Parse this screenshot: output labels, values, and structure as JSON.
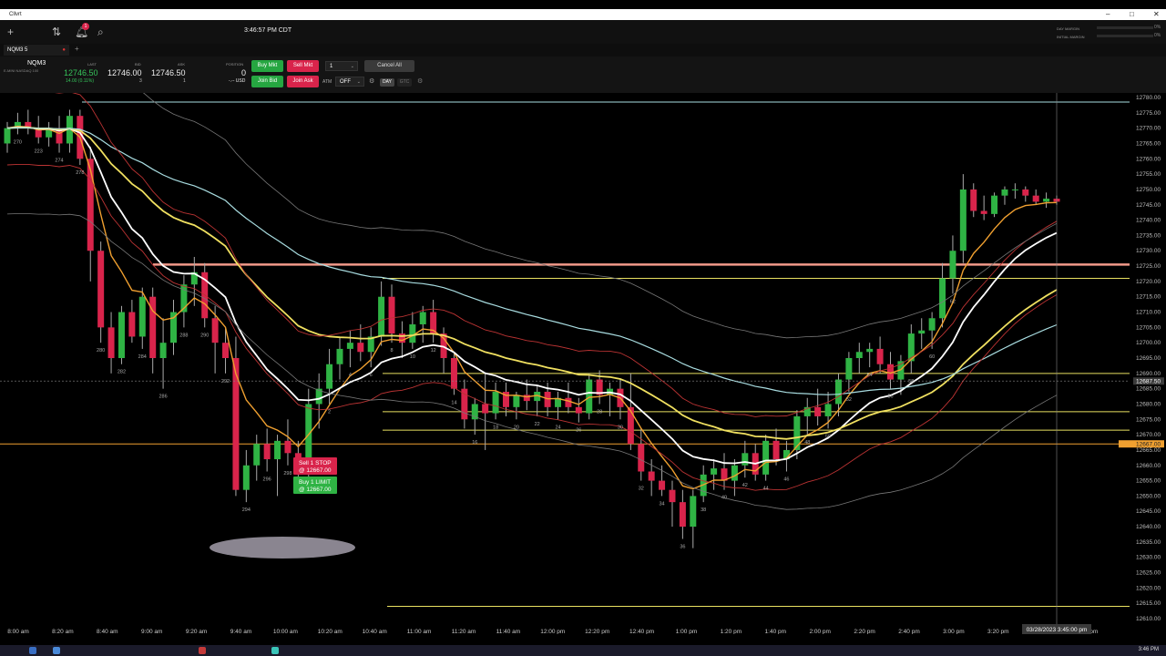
{
  "window": {
    "title": "Cllvrt"
  },
  "header": {
    "time": "3:46:57 PM CDT",
    "notification_count": "1",
    "day_margin_label": "DAY MARGIN",
    "initial_margin_label": "INITIAL MARGIN",
    "day_margin_pct": "0%",
    "initial_margin_pct": "0%"
  },
  "tab": {
    "label": "NQM3 5"
  },
  "quote": {
    "symbol": "NQM3",
    "description": "E-MINI NASDAQ 100",
    "last_label": "LAST",
    "last": "12746.50",
    "change": "14.00 (0.11%)",
    "bid_label": "BID",
    "bid": "12746.00",
    "bid_size": "3",
    "ask_label": "ASK",
    "ask": "12746.50",
    "ask_size": "1",
    "position_label": "POSITION",
    "position": "0",
    "pnl": "-.-- USD"
  },
  "order_entry": {
    "buy_mkt": "Buy Mkt",
    "sell_mkt": "Sell Mkt",
    "qty": "1",
    "cancel_all": "Cancel All",
    "join_bid": "Join Bid",
    "join_ask": "Join Ask",
    "atm_label": "ATM",
    "atm_value": "OFF",
    "day": "DAY",
    "gtc": "GTC"
  },
  "chart_data": {
    "type": "candlestick",
    "y_ticks": [
      "12780.00",
      "12775.00",
      "12770.00",
      "12765.00",
      "12760.00",
      "12755.00",
      "12750.00",
      "12745.00",
      "12740.00",
      "12735.00",
      "12730.00",
      "12725.00",
      "12720.00",
      "12715.00",
      "12710.00",
      "12705.00",
      "12700.00",
      "12695.00",
      "12690.00",
      "12685.00",
      "12680.00",
      "12675.00",
      "12670.00",
      "12665.00",
      "12660.00",
      "12655.00",
      "12650.00",
      "12645.00",
      "12640.00",
      "12635.00",
      "12630.00",
      "12625.00",
      "12620.00",
      "12615.00",
      "12610.00"
    ],
    "ylim": [
      12610,
      12780
    ],
    "x_ticks": [
      "8:00 am",
      "8:20 am",
      "8:40 am",
      "9:00 am",
      "9:20 am",
      "9:40 am",
      "10:00 am",
      "10:20 am",
      "10:40 am",
      "11:00 am",
      "11:20 am",
      "11:40 am",
      "12:00 pm",
      "12:20 pm",
      "12:40 pm",
      "1:00 pm",
      "1:20 pm",
      "1:40 pm",
      "2:00 pm",
      "2:20 pm",
      "2:40 pm",
      "3:00 pm",
      "3:20 pm",
      "3:40 pm",
      "4:00 pm"
    ],
    "crosshair_time": "03/28/2023 3:45:00 pm",
    "crosshair_price": "12687.50",
    "price_flags": [
      "12667.00",
      "12667.00"
    ],
    "horizontal_levels": [
      12778.5,
      12725.5,
      12721.0,
      12690.0,
      12677.5,
      12671.5,
      12667.0,
      12614.0
    ],
    "orders": [
      {
        "label": "Sell 1 STOP",
        "price_label": "@ 12667.00",
        "side": "sell"
      },
      {
        "label": "Buy 1 LIMIT",
        "price_label": "@ 12667.00",
        "side": "buy"
      }
    ],
    "candles": [
      [
        12765,
        12772,
        12762,
        12770
      ],
      [
        12770,
        12775,
        12768,
        12772
      ],
      [
        12772,
        12776,
        12768,
        12770
      ],
      [
        12770,
        12774,
        12765,
        12767
      ],
      [
        12767,
        12772,
        12764,
        12770
      ],
      [
        12770,
        12774,
        12762,
        12765
      ],
      [
        12765,
        12776,
        12762,
        12774
      ],
      [
        12774,
        12776,
        12758,
        12760
      ],
      [
        12760,
        12764,
        12720,
        12730
      ],
      [
        12730,
        12733,
        12700,
        12705
      ],
      [
        12705,
        12710,
        12690,
        12695
      ],
      [
        12695,
        12712,
        12693,
        12710
      ],
      [
        12710,
        12714,
        12700,
        12702
      ],
      [
        12702,
        12718,
        12698,
        12715
      ],
      [
        12715,
        12718,
        12690,
        12695
      ],
      [
        12695,
        12708,
        12685,
        12700
      ],
      [
        12700,
        12714,
        12696,
        12710
      ],
      [
        12710,
        12722,
        12705,
        12719
      ],
      [
        12719,
        12728,
        12712,
        12723
      ],
      [
        12723,
        12726,
        12705,
        12708
      ],
      [
        12708,
        12712,
        12690,
        12700
      ],
      [
        12700,
        12705,
        12690,
        12695
      ],
      [
        12695,
        12702,
        12650,
        12652
      ],
      [
        12652,
        12665,
        12648,
        12660
      ],
      [
        12660,
        12670,
        12655,
        12667
      ],
      [
        12667,
        12672,
        12658,
        12662
      ],
      [
        12662,
        12670,
        12650,
        12668
      ],
      [
        12668,
        12675,
        12660,
        12664
      ],
      [
        12664,
        12668,
        12652,
        12658
      ],
      [
        12658,
        12685,
        12655,
        12680
      ],
      [
        12680,
        12690,
        12672,
        12685
      ],
      [
        12685,
        12698,
        12680,
        12693
      ],
      [
        12693,
        12702,
        12688,
        12698
      ],
      [
        12698,
        12704,
        12692,
        12700
      ],
      [
        12700,
        12706,
        12694,
        12697
      ],
      [
        12697,
        12705,
        12692,
        12702
      ],
      [
        12702,
        12720,
        12699,
        12715
      ],
      [
        12715,
        12719,
        12700,
        12703
      ],
      [
        12703,
        12707,
        12695,
        12700
      ],
      [
        12700,
        12710,
        12698,
        12706
      ],
      [
        12706,
        12712,
        12700,
        12710
      ],
      [
        12710,
        12714,
        12700,
        12703
      ],
      [
        12703,
        12705,
        12690,
        12695
      ],
      [
        12695,
        12697,
        12683,
        12685
      ],
      [
        12685,
        12688,
        12672,
        12675
      ],
      [
        12675,
        12682,
        12670,
        12680
      ],
      [
        12680,
        12690,
        12665,
        12677
      ],
      [
        12677,
        12687,
        12675,
        12684
      ],
      [
        12684,
        12687,
        12676,
        12679
      ],
      [
        12679,
        12684,
        12675,
        12683
      ],
      [
        12683,
        12688,
        12678,
        12681
      ],
      [
        12681,
        12686,
        12676,
        12684
      ],
      [
        12684,
        12687,
        12676,
        12679
      ],
      [
        12679,
        12684,
        12675,
        12682
      ],
      [
        12682,
        12687,
        12677,
        12679
      ],
      [
        12679,
        12682,
        12674,
        12677
      ],
      [
        12677,
        12690,
        12675,
        12688
      ],
      [
        12688,
        12691,
        12680,
        12683
      ],
      [
        12683,
        12687,
        12676,
        12685
      ],
      [
        12685,
        12688,
        12675,
        12679
      ],
      [
        12679,
        12690,
        12665,
        12667
      ],
      [
        12667,
        12672,
        12655,
        12658
      ],
      [
        12658,
        12662,
        12650,
        12655
      ],
      [
        12655,
        12660,
        12650,
        12652
      ],
      [
        12652,
        12655,
        12640,
        12648
      ],
      [
        12648,
        12652,
        12636,
        12640
      ],
      [
        12640,
        12652,
        12633,
        12650
      ],
      [
        12650,
        12660,
        12648,
        12657
      ],
      [
        12657,
        12662,
        12652,
        12659
      ],
      [
        12659,
        12664,
        12652,
        12655
      ],
      [
        12655,
        12662,
        12650,
        12660
      ],
      [
        12660,
        12668,
        12656,
        12664
      ],
      [
        12664,
        12667,
        12655,
        12657
      ],
      [
        12657,
        12670,
        12655,
        12668
      ],
      [
        12668,
        12672,
        12660,
        12662
      ],
      [
        12662,
        12668,
        12658,
        12665
      ],
      [
        12665,
        12678,
        12662,
        12676
      ],
      [
        12676,
        12682,
        12670,
        12679
      ],
      [
        12679,
        12685,
        12673,
        12676
      ],
      [
        12676,
        12684,
        12672,
        12680
      ],
      [
        12680,
        12690,
        12676,
        12688
      ],
      [
        12688,
        12697,
        12684,
        12695
      ],
      [
        12695,
        12700,
        12690,
        12697
      ],
      [
        12697,
        12700,
        12692,
        12698
      ],
      [
        12698,
        12702,
        12690,
        12693
      ],
      [
        12693,
        12697,
        12685,
        12688
      ],
      [
        12688,
        12696,
        12683,
        12694
      ],
      [
        12694,
        12706,
        12690,
        12703
      ],
      [
        12703,
        12708,
        12698,
        12704
      ],
      [
        12704,
        12710,
        12698,
        12708
      ],
      [
        12708,
        12726,
        12705,
        12721
      ],
      [
        12721,
        12735,
        12716,
        12730
      ],
      [
        12730,
        12755,
        12726,
        12750
      ],
      [
        12750,
        12752,
        12741,
        12743
      ],
      [
        12743,
        12748,
        12740,
        12742
      ],
      [
        12742,
        12749,
        12741,
        12748
      ],
      [
        12748,
        12751,
        12745,
        12750
      ],
      [
        12750,
        12752,
        12747,
        12750
      ],
      [
        12750,
        12751,
        12746,
        12748
      ],
      [
        12748,
        12750,
        12745,
        12746
      ],
      [
        12746,
        12749,
        12744,
        12747
      ],
      [
        12747,
        12748,
        12745,
        12746
      ]
    ],
    "bar_labels": [
      "270",
      "223",
      "274",
      "278",
      "280",
      "282",
      "284",
      "286",
      "288",
      "290",
      "292",
      "294",
      "296",
      "298",
      "300",
      "2",
      "4",
      "6",
      "8",
      "10",
      "12",
      "14",
      "16",
      "18",
      "20",
      "22",
      "24",
      "26",
      "28",
      "30",
      "32",
      "34",
      "36",
      "38",
      "40",
      "42",
      "44",
      "46",
      "48",
      "50",
      "52",
      "54",
      "56",
      "58",
      "60",
      "62"
    ]
  }
}
